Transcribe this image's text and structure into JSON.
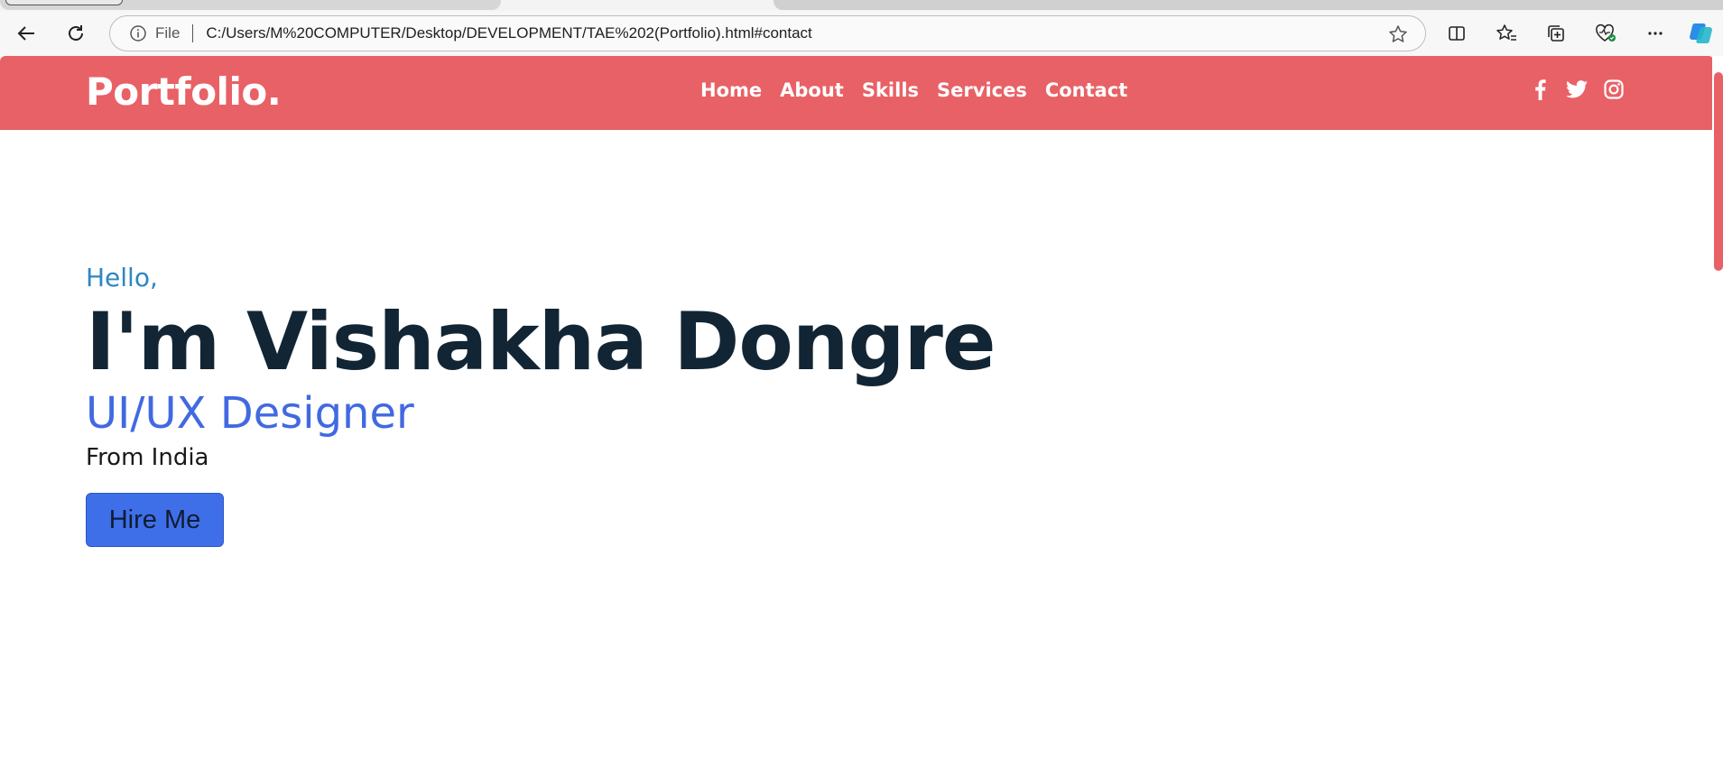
{
  "browser": {
    "address": {
      "scheme_label": "File",
      "url": "C:/Users/M%20COMPUTER/Desktop/DEVELOPMENT/TAE%202(Portfolio).html#contact"
    }
  },
  "site": {
    "logo": "Portfolio.",
    "nav": [
      {
        "label": "Home"
      },
      {
        "label": "About"
      },
      {
        "label": "Skills"
      },
      {
        "label": "Services"
      },
      {
        "label": "Contact"
      }
    ],
    "socials": [
      {
        "icon": "facebook-icon"
      },
      {
        "icon": "twitter-icon"
      },
      {
        "icon": "instagram-icon"
      }
    ],
    "colors": {
      "header": "#e86166",
      "accent_blue": "#4169e1",
      "greeting": "#2d86c2",
      "heading": "#122534"
    }
  },
  "hero": {
    "greeting": "Hello,",
    "name": "I'm Vishakha Dongre",
    "role": "UI/UX Designer",
    "location": "From India",
    "cta_label": "Hire Me"
  }
}
